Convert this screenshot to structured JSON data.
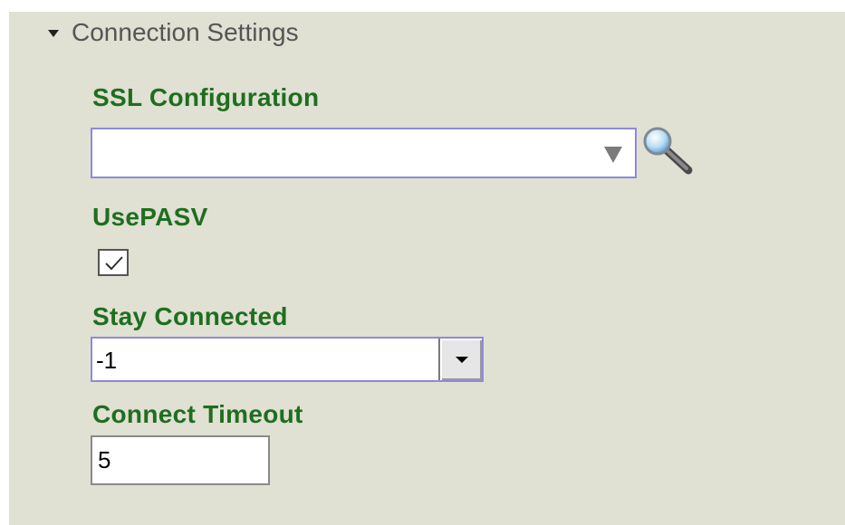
{
  "section": {
    "title": "Connection Settings",
    "icon": "collapse-triangle-icon"
  },
  "ssl": {
    "label": "SSL Configuration",
    "value": "",
    "lookup_icon": "magnifier-icon"
  },
  "pasv": {
    "label": "UsePASV",
    "checked": true
  },
  "stay_connected": {
    "label": "Stay Connected",
    "value": "-1"
  },
  "connect_timeout": {
    "label": "Connect Timeout",
    "value": "5"
  },
  "colors": {
    "label": "#1f6e1f",
    "panel": "#e0e0d3",
    "focus_border": "#8f8ad9"
  }
}
